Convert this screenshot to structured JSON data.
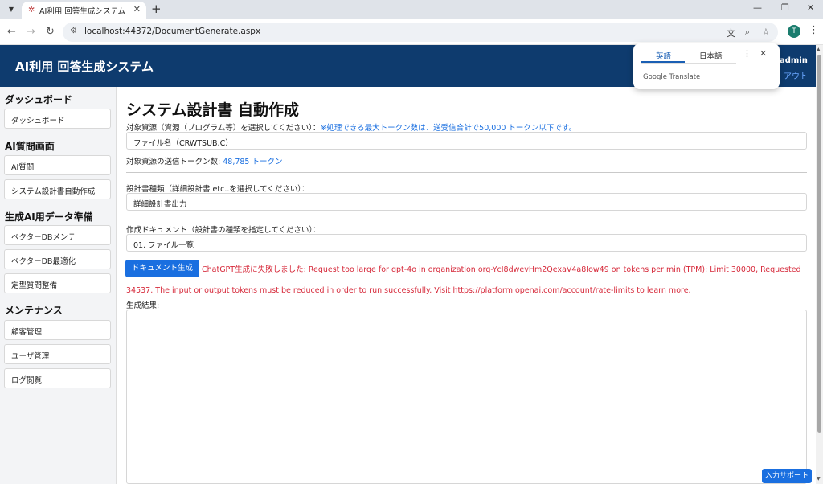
{
  "browser": {
    "tab_title": "AI利用 回答生成システム",
    "url": "localhost:44372/DocumentGenerate.aspx"
  },
  "header": {
    "app_title": "AI利用 回答生成システム",
    "user": "admin",
    "logout": "アウト"
  },
  "translate_popup": {
    "tab_english": "英語",
    "tab_japanese": "日本語",
    "brand": "Google Translate"
  },
  "sidebar": {
    "sections": [
      {
        "heading": "ダッシュボード",
        "items": [
          "ダッシュボード"
        ]
      },
      {
        "heading": "AI質問画面",
        "items": [
          "AI質問",
          "システム設計書自動作成"
        ]
      },
      {
        "heading": "生成AI用データ準備",
        "items": [
          "ベクターDBメンテ",
          "ベクターDB最適化",
          "定型質問整備"
        ]
      },
      {
        "heading": "メンテナンス",
        "items": [
          "顧客管理",
          "ユーザ管理",
          "ログ閲覧"
        ]
      }
    ]
  },
  "main": {
    "title": "システム設計書 自動作成",
    "resource_label": "対象資源（資源（プログラム等）を選択してください）：",
    "resource_note": "※処理できる最大トークン数は、送受信合計で50,000 トークン以下です。",
    "resource_value": "ファイル名（CRWTSUB.C）",
    "token_label": "対象資源の送信トークン数: ",
    "token_value": "48,785 トークン",
    "doc_type_label": "設計書種類（詳細設計書 etc..を選択してください）：",
    "doc_type_value": "詳細設計書出力",
    "document_label": "作成ドキュメント（設計書の種類を指定してください）：",
    "document_value": "01. ファイル一覧",
    "generate_button": "ドキュメント生成",
    "error_message": "ChatGPT生成に失敗しました: Request too large for gpt-4o in organization org-YcI8dwevHm2QexaV4a8Iow49 on tokens per min (TPM): Limit 30000, Requested 34537. The input or output tokens must be reduced in order to run successfully. Visit https://platform.openai.com/account/rate-limits to learn more.",
    "result_label": "生成結果:",
    "help_button": "入力サポート"
  },
  "colors": {
    "header_bg": "#0e3b6e",
    "primary": "#1a6fe0",
    "error": "#d62839"
  }
}
